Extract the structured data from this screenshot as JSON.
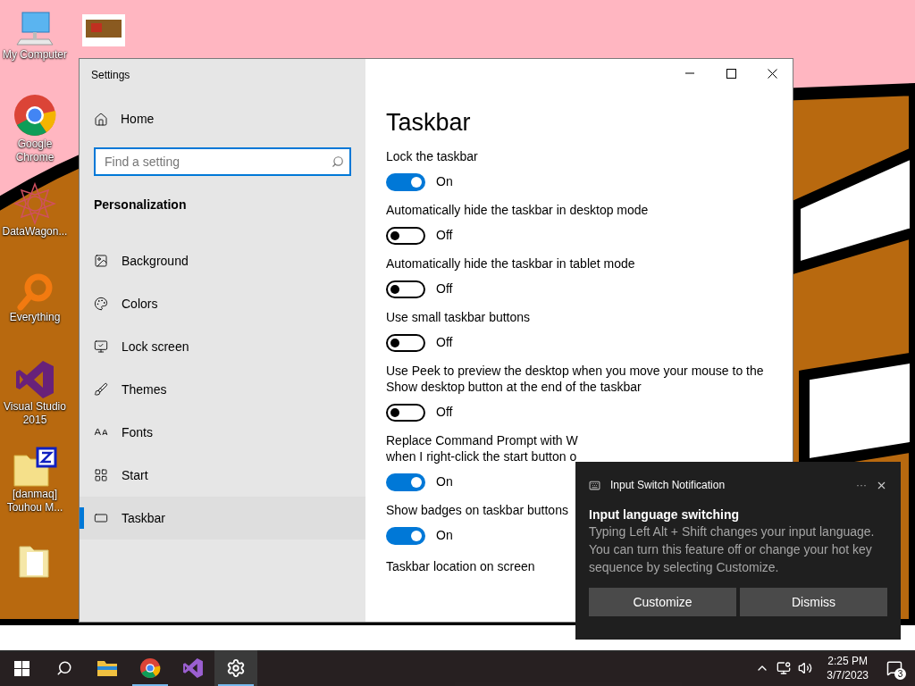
{
  "desktop_icons": [
    {
      "label": "My Computer"
    },
    {
      "label": "Google Chrome"
    },
    {
      "label": "DataWagon..."
    },
    {
      "label": "Everything"
    },
    {
      "label": "Visual Studio 2015"
    },
    {
      "label": "[danmaq] Touhou M..."
    }
  ],
  "window": {
    "title": "Settings"
  },
  "sidebar": {
    "home": "Home",
    "search": {
      "placeholder": "Find a setting"
    },
    "section": "Personalization",
    "items": [
      {
        "label": "Background",
        "selected": false
      },
      {
        "label": "Colors",
        "selected": false
      },
      {
        "label": "Lock screen",
        "selected": false
      },
      {
        "label": "Themes",
        "selected": false
      },
      {
        "label": "Fonts",
        "selected": false
      },
      {
        "label": "Start",
        "selected": false
      },
      {
        "label": "Taskbar",
        "selected": true
      }
    ]
  },
  "content": {
    "title": "Taskbar",
    "settings": [
      {
        "lines": [
          "Lock the taskbar"
        ],
        "on": true,
        "state": "On"
      },
      {
        "lines": [
          "Automatically hide the taskbar in desktop mode"
        ],
        "on": false,
        "state": "Off"
      },
      {
        "lines": [
          "Automatically hide the taskbar in tablet mode"
        ],
        "on": false,
        "state": "Off"
      },
      {
        "lines": [
          "Use small taskbar buttons"
        ],
        "on": false,
        "state": "Off"
      },
      {
        "lines": [
          "Use Peek to preview the desktop when you move your mouse to the",
          "Show desktop button at the end of the taskbar"
        ],
        "on": false,
        "state": "Off"
      },
      {
        "lines": [
          "Replace Command Prompt with W",
          "when I right-click the start button o"
        ],
        "on": true,
        "state": "On"
      },
      {
        "lines": [
          "Show badges on taskbar buttons"
        ],
        "on": true,
        "state": "On"
      }
    ],
    "last_label": "Taskbar location on screen"
  },
  "notification": {
    "app": "Input Switch Notification",
    "more": "···",
    "title": "Input language switching",
    "body": "Typing Left Alt + Shift changes your input language. You can turn this feature off or change your hot key sequence by selecting Customize.",
    "buttons": [
      "Customize",
      "Dismiss"
    ]
  },
  "taskbar": {
    "apps": [
      {
        "kind": "explorer",
        "running": false,
        "active": false
      },
      {
        "kind": "chrome",
        "running": true,
        "active": false
      },
      {
        "kind": "vs",
        "running": false,
        "active": false
      },
      {
        "kind": "settings",
        "running": true,
        "active": true
      }
    ],
    "time": "2:25 PM",
    "date": "3/7/2023",
    "notification_count": "3"
  }
}
